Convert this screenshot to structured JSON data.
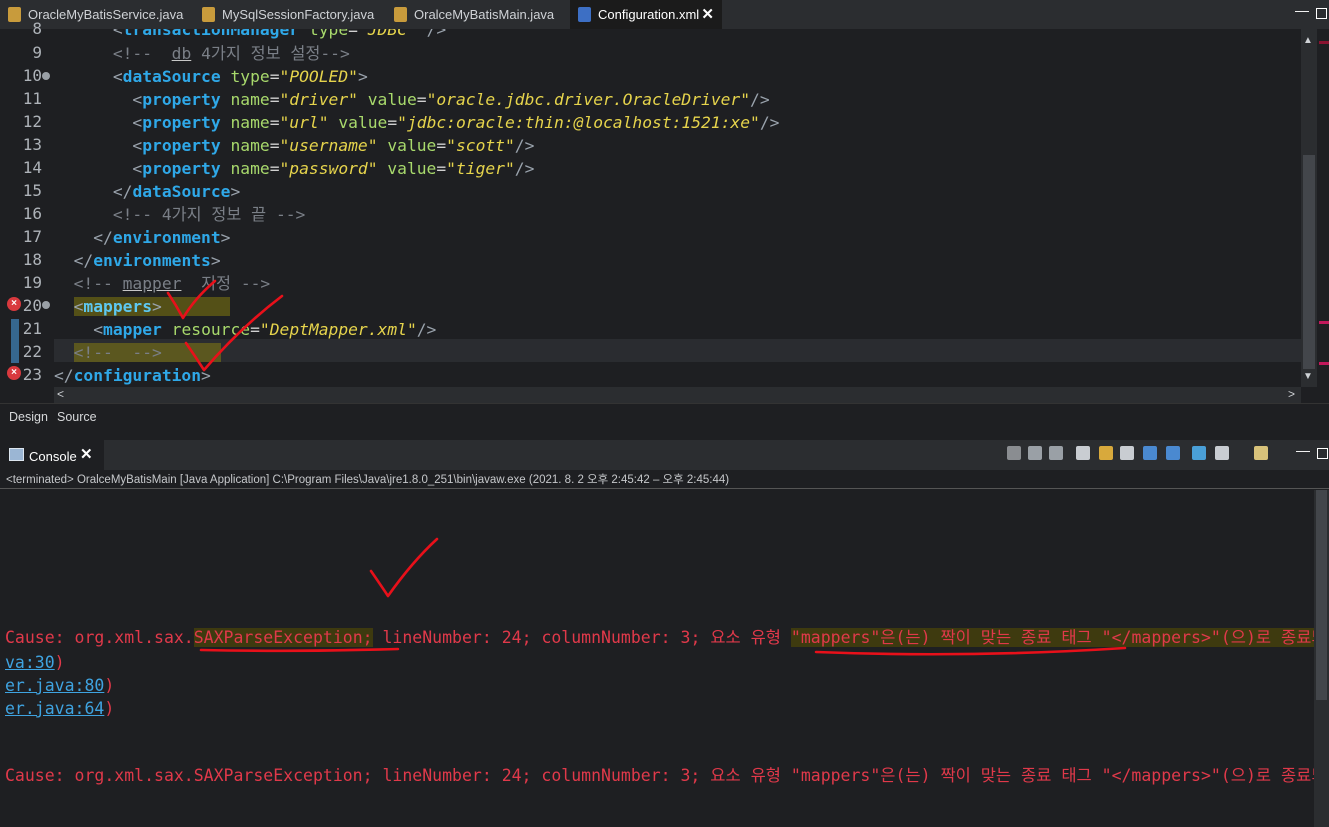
{
  "tabs": [
    {
      "label": "OracleMyBatisService.java",
      "type": "java"
    },
    {
      "label": "MySqlSessionFactory.java",
      "type": "java"
    },
    {
      "label": "OralceMyBatisMain.java",
      "type": "java"
    },
    {
      "label": "Configuration.xml",
      "type": "xml",
      "active": true
    }
  ],
  "active_tab_close": "✕",
  "editor": {
    "line_numbers": [
      "8",
      "9",
      "10",
      "11",
      "12",
      "13",
      "14",
      "15",
      "16",
      "17",
      "18",
      "19",
      "20",
      "21",
      "22",
      "23"
    ],
    "lines": {
      "l8": {
        "indent": "      ",
        "tag": "transactionManager",
        "attr": "type",
        "val": "\"JDBC\"",
        "close": "/>"
      },
      "l9": {
        "indent": "      ",
        "comment_open": "<!--",
        "squig": "db",
        "comment_rest": " 4가지 정보 설정-->"
      },
      "l10": {
        "indent": "      ",
        "tag": "dataSource",
        "attr": "type",
        "val": "\"POOLED\""
      },
      "l11": {
        "indent": "        ",
        "tag": "property",
        "attr1": "name",
        "val1": "\"driver\"",
        "attr2": "value",
        "val2": "\"oracle.jdbc.driver.OracleDriver\""
      },
      "l12": {
        "indent": "        ",
        "tag": "property",
        "attr1": "name",
        "val1": "\"url\"",
        "attr2": "value",
        "val2": "\"jdbc:oracle:thin:@localhost:1521:xe\""
      },
      "l13": {
        "indent": "        ",
        "tag": "property",
        "attr1": "name",
        "val1": "\"username\"",
        "attr2": "value",
        "val2": "\"scott\""
      },
      "l14": {
        "indent": "        ",
        "tag": "property",
        "attr1": "name",
        "val1": "\"password\"",
        "attr2": "value",
        "val2": "\"tiger\""
      },
      "l15": {
        "indent": "      ",
        "tag": "dataSource"
      },
      "l16": {
        "indent": "      ",
        "comment": "<!-- 4가지 정보 끝 -->"
      },
      "l17": {
        "indent": "    ",
        "tag": "environment"
      },
      "l18": {
        "indent": "  ",
        "tag": "environments"
      },
      "l19": {
        "indent": "  ",
        "comment_open": "<!-- ",
        "squig": "mapper",
        "comment_rest": "  지정 -->"
      },
      "l20": {
        "indent": "  ",
        "tag": "mappers"
      },
      "l21": {
        "indent": "    ",
        "tag": "mapper",
        "attr": "resource",
        "val": "\"DeptMapper.xml\""
      },
      "l22": {
        "indent": "  ",
        "comment": "<!--  -->"
      },
      "l23": {
        "indent": "",
        "tag": "configuration"
      }
    }
  },
  "bottom_tabs": {
    "design": "Design",
    "source": "Source"
  },
  "console": {
    "title": "Console",
    "close": "✕",
    "status": "<terminated> OralceMyBatisMain [Java Application] C:\\Program Files\\Java\\jre1.8.0_251\\bin\\javaw.exe  (2021. 8. 2 오후 2:45:42 – 오후 2:45:44)",
    "lines": [
      {
        "pre": "Cause: org.xml.sax.",
        "exc": "SAXParseException;",
        "mid": " lineNumber: 24; columnNumber: 3; 요소 유형 ",
        "hl": "\"mappers\"은(는) 짝이 맞는 종료 태그 \"</mappers>\"(으)로 종료되어야 합니다."
      },
      {
        "link": "va:30",
        "tail": ")"
      },
      {
        "link": "er.java:80",
        "tail": ")"
      },
      {
        "link": "er.java:64",
        "tail": ")"
      },
      {
        "plain": "Cause: org.xml.sax.SAXParseException; lineNumber: 24; columnNumber: 3; 요소 유형 \"mappers\"은(는) 짝이 맞는 종료 태그 \"</mappers>\"(으)로 종료되어야 합니다."
      }
    ]
  },
  "colors": {
    "tag": "#2fa8e8",
    "attr": "#a8d96c",
    "value": "#e6d44c",
    "comment": "#7a7f87",
    "error": "#e0394a",
    "annotation": "#e8101a"
  }
}
